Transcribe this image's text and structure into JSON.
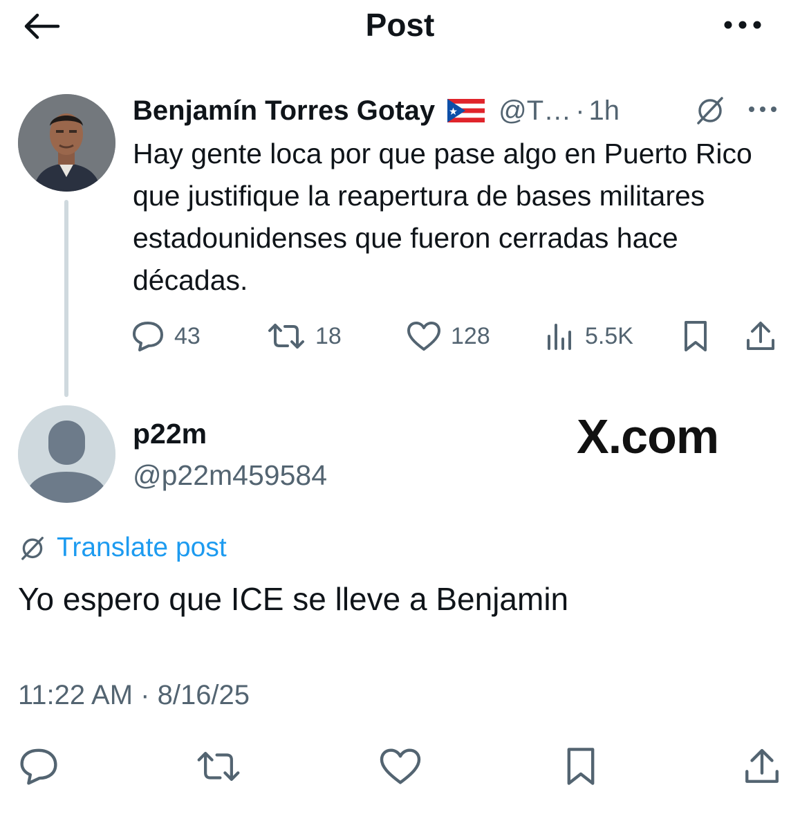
{
  "header": {
    "title": "Post",
    "back_icon": "arrow-left-icon",
    "more_icon": "more-horizontal-icon"
  },
  "parent_post": {
    "author_name": "Benjamín Torres Gotay",
    "flag_icon": "puerto-rico-flag-icon",
    "handle": "@T…",
    "separator": "·",
    "time": "1h",
    "body": "Hay gente loca por que pase algo en Puerto Rico que justifique la reapertura de bases militares estadounidenses que fueron cerradas hace décadas.",
    "actions": {
      "replies": "43",
      "reposts": "18",
      "likes": "128",
      "views": "5.5K"
    }
  },
  "reply_post": {
    "author_name": "p22m",
    "handle": "@p22m459584",
    "watermark": "X.com",
    "translate_label": "Translate post",
    "body": "Yo espero que ICE se lleve a Benjamin",
    "timestamp": "11:22 AM · 8/16/25"
  },
  "colors": {
    "text_primary": "#0f1419",
    "text_secondary": "#536471",
    "link": "#1d9bf0",
    "thread_line": "#cfd9de"
  }
}
